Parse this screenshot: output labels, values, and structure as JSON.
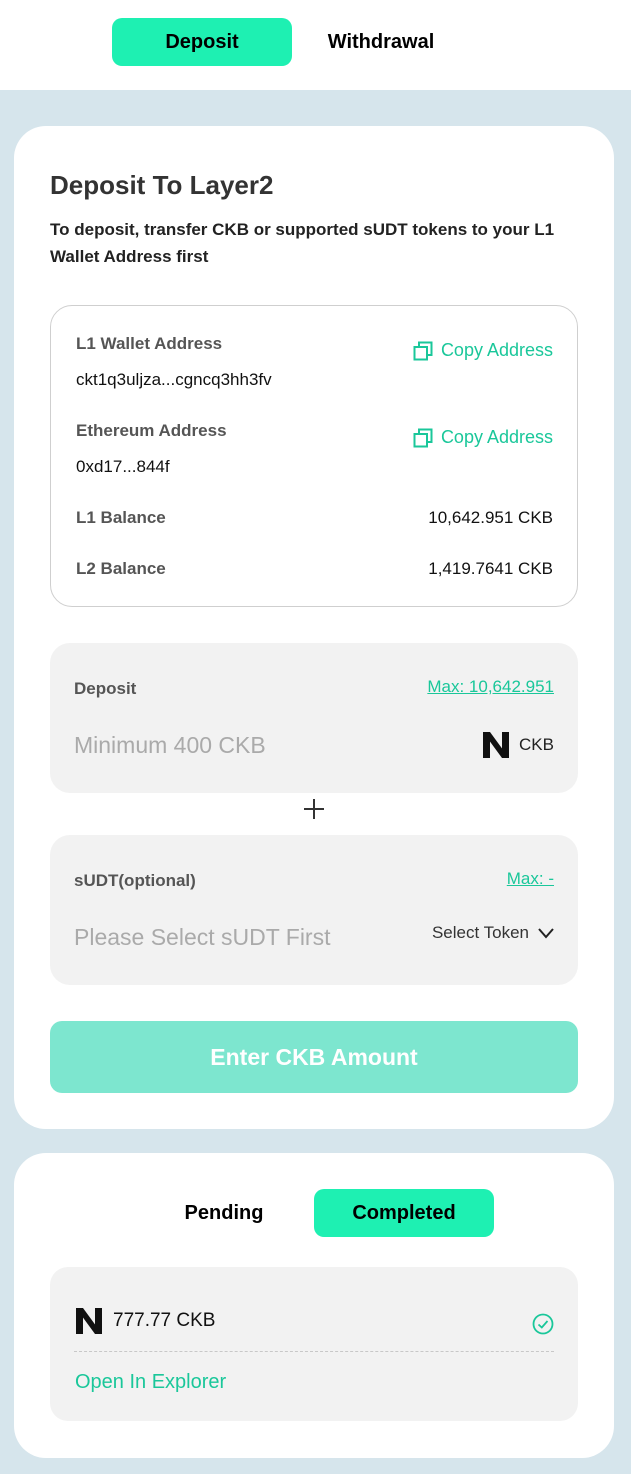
{
  "tabs": {
    "deposit": "Deposit",
    "withdrawal": "Withdrawal"
  },
  "deposit_card": {
    "title": "Deposit To Layer2",
    "subtitle": "To deposit, transfer CKB or supported sUDT tokens to your L1 Wallet Address first",
    "l1_wallet_label": "L1 Wallet Address",
    "l1_wallet_value": "ckt1q3uljza...cgncq3hh3fv",
    "eth_label": "Ethereum Address",
    "eth_value": "0xd17...844f",
    "copy_label": "Copy Address",
    "l1_balance_label": "L1 Balance",
    "l1_balance_value": "10,642.951 CKB",
    "l2_balance_label": "L2 Balance",
    "l2_balance_value": "1,419.7641 CKB"
  },
  "deposit_panel": {
    "label": "Deposit",
    "max": "Max: 10,642.951",
    "placeholder": "Minimum 400 CKB",
    "token": "CKB"
  },
  "sudt_panel": {
    "label": "sUDT(optional)",
    "max": "Max: -",
    "placeholder": "Please Select sUDT First",
    "select": "Select Token"
  },
  "submit_button": "Enter CKB Amount",
  "history": {
    "tabs": {
      "pending": "Pending",
      "completed": "Completed"
    },
    "items": [
      {
        "amount": "777.77 CKB",
        "link": "Open In Explorer"
      }
    ]
  },
  "colors": {
    "accent": "#1ef0b2",
    "link": "#1ac79a",
    "button_disabled": "#7de6cf",
    "background": "#d6e5ec"
  },
  "icons": [
    "copy-icon",
    "nervos-logo-icon",
    "chevron-down-icon",
    "plus-icon",
    "check-circle-icon"
  ]
}
